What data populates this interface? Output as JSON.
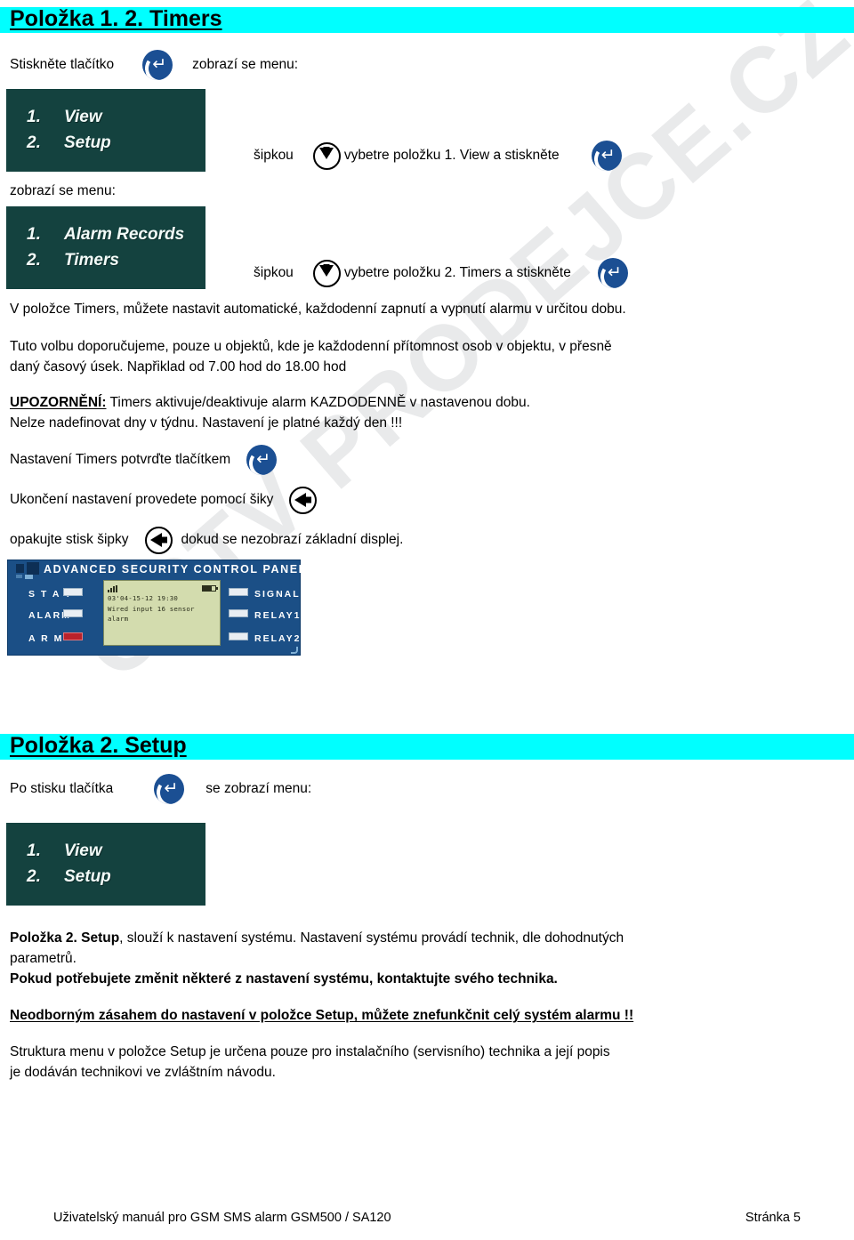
{
  "colors": {
    "heading_highlight": "#00ffff",
    "lcd_background": "#14423f",
    "lcd_text": "#f2fbf8",
    "enter_button": "#1b4f93",
    "panel_background": "#1b4f86",
    "panel_lcd": "#d3dcae",
    "watermark": "rgba(60,72,78,0.115)"
  },
  "watermark": {
    "text": "CCTV PRODEJCE.CZ"
  },
  "section1": {
    "heading": "Položka 1. 2. Timers",
    "press_line": {
      "before": "Stiskněte tlačítko",
      "icon": "enter-button-icon",
      "after": "zobrazí se menu:"
    },
    "menu1": {
      "rows": [
        {
          "num": "1.",
          "label": "View"
        },
        {
          "num": "2.",
          "label": "Setup"
        }
      ]
    },
    "select_line1": {
      "before": "šipkou",
      "icon_down": "arrow-down-button-icon",
      "middle": "vybetre položku 1. View a stiskněte",
      "icon_enter": "enter-button-icon"
    },
    "shown_menu_label": "zobrazí se menu:",
    "menu2": {
      "rows": [
        {
          "num": "1.",
          "label": "Alarm Records"
        },
        {
          "num": "2.",
          "label": "Timers"
        }
      ]
    },
    "select_line2": {
      "before": "šipkou",
      "icon_down": "arrow-down-button-icon",
      "middle": "vybetre položku 2. Timers a stiskněte",
      "icon_enter": "enter-button-icon"
    },
    "paragraph1": "V položce Timers, můžete nastavit automatické, každodenní zapnutí a vypnutí alarmu v určitou dobu.",
    "paragraph2_line1": "Tuto volbu doporučujeme, pouze u objektů, kde je každodenní přítomnost osob v objektu, v přesně",
    "paragraph2_line2": "daný časový úsek. Napřiklad od 7.00 hod do 18.00 hod",
    "warning": {
      "label": "UPOZORNĚNÍ:",
      "text_line1": "Timers aktivuje/deaktivuje alarm KAZDODENNĚ v nastavenou dobu.",
      "text_line2": "Nelze nadefinovat dny v týdnu. Nastavení je platné každý den !!!"
    },
    "confirm_line": {
      "before": "Nastavení Timers potvrďte tlačítkem",
      "icon": "enter-button-icon"
    },
    "exit_line": {
      "before": "Ukončení nastavení provedete pomocí šiky",
      "icon": "arrow-left-button-icon"
    },
    "repeat_line": {
      "before": "opakujte stisk šipky",
      "icon": "arrow-left-button-icon",
      "after": "dokud se nezobrazí základní displej."
    },
    "control_panel": {
      "title": "ADVANCED SECURITY CONTROL PANEL",
      "left_labels": [
        "S T A Y",
        "ALARM",
        "A R M"
      ],
      "right_labels": [
        "SIGNAL",
        "RELAY1",
        "RELAY2"
      ],
      "lcd": {
        "signal_icon": "signal-bars-icon",
        "battery_icon": "battery-icon",
        "line1": "03'04-15-12  19:30",
        "line2": "Wired input 16 sensor",
        "line3": "alarm"
      }
    }
  },
  "section2": {
    "heading": "Položka 2. Setup",
    "press_line": {
      "before": "Po stisku tlačítka",
      "icon": "enter-button-icon",
      "after": "se zobrazí menu:"
    },
    "menu3": {
      "rows": [
        {
          "num": "1.",
          "label": "View"
        },
        {
          "num": "2.",
          "label": "Setup"
        }
      ]
    },
    "para_bold_lead": "Položka 2. Setup",
    "para_rest_line1": ", slouží k nastavení systému. Nastavení systému provádí technik, dle dohodnutých",
    "para_rest_line2": "parametrů.",
    "para_bold_line": "Pokud potřebujete změnit některé z nastavení systému, kontaktujte svého technika.",
    "warning_underlined": "Neodborným zásahem do nastavení v položce Setup, můžete znefunkčnit celý systém alarmu !!",
    "final_line1": "Struktura menu v položce Setup je určena pouze pro instalačního (servisního) technika a její popis",
    "final_line2": "je dodáván technikovi ve zvláštním návodu."
  },
  "footer": {
    "left": "Uživatelský manuál pro GSM SMS alarm GSM500 / SA120",
    "right": "Stránka 5"
  }
}
